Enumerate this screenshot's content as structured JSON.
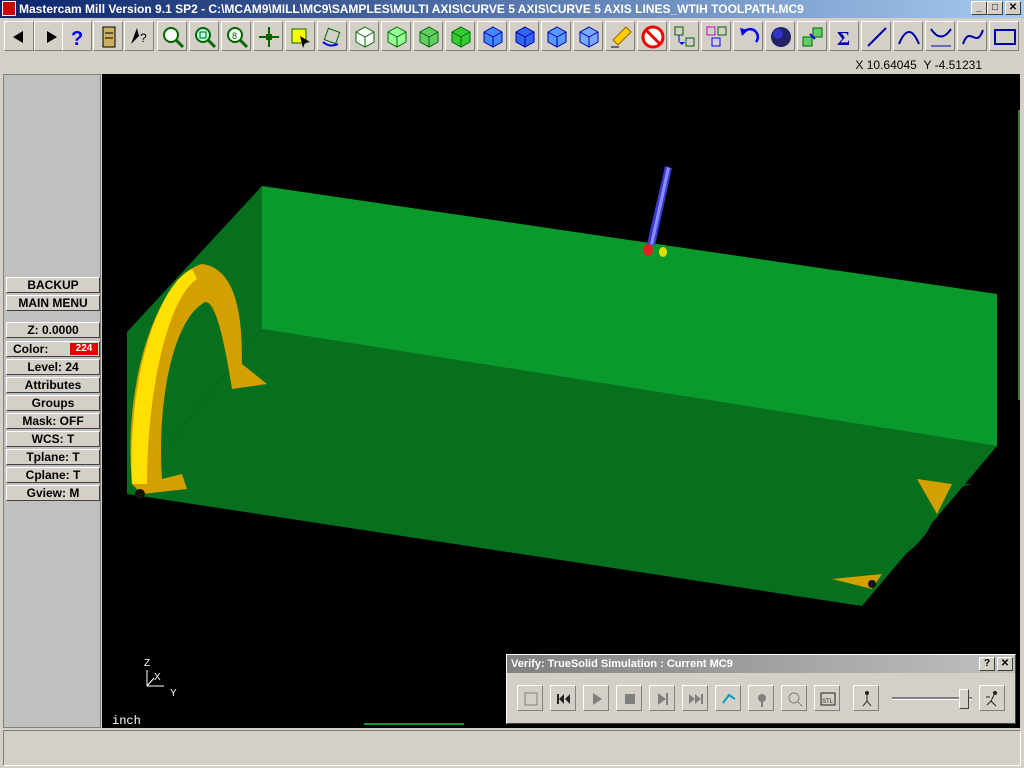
{
  "window": {
    "title": "Mastercam Mill Version 9.1 SP2 - C:\\MCAM9\\MILL\\MC9\\SAMPLES\\MULTI AXIS\\CURVE 5 AXIS\\CURVE 5 AXIS LINES_WTIH TOOLPATH.MC9"
  },
  "toolbar": {
    "icons": [
      "back-arrow-icon",
      "forward-arrow-icon",
      "help-icon",
      "file-icon",
      "whatis-icon",
      "zoom-icon",
      "unzoom-icon",
      "zoom-fit-icon",
      "pan-icon",
      "select-icon",
      "rotate-icon",
      "view-top-icon",
      "view-front-icon",
      "view-side-icon",
      "view-iso-icon",
      "view-cube-a-icon",
      "view-cube-b-icon",
      "view-cube-c-icon",
      "view-cube-d-icon",
      "eraser-icon",
      "no-icon",
      "transform-icon",
      "transform2-icon",
      "undo-icon",
      "sphere-icon",
      "cube-stack-icon",
      "sigma-icon",
      "line-icon",
      "arc-icon",
      "fillet-icon",
      "spline-icon",
      "rectangle-icon"
    ]
  },
  "coords": {
    "x_label": "X",
    "x": "10.64045",
    "y_label": "Y",
    "y": "-4.51231"
  },
  "menu": {
    "backup": "BACKUP",
    "main_menu": "MAIN MENU",
    "z": "Z:  0.0000",
    "color_label": "Color:",
    "color_value": "224",
    "level": "Level: 24",
    "attributes": "Attributes",
    "groups": "Groups",
    "mask": "Mask:  OFF",
    "wcs": "WCS:   T",
    "tplane": "Tplane:  T",
    "cplane": "Cplane:  T",
    "gview": "Gview:   M"
  },
  "viewport": {
    "unit": "inch",
    "axis_z": "Z",
    "axis_x": "X",
    "axis_y": "Y"
  },
  "verify": {
    "title": "Verify: TrueSolid Simulation : Current MC9",
    "help": "?",
    "close": "✕"
  },
  "colors": {
    "stock": "#0a9a2c",
    "stock_dark": "#07701f",
    "tool": "#3a3acc",
    "cut": "#d4a000"
  }
}
